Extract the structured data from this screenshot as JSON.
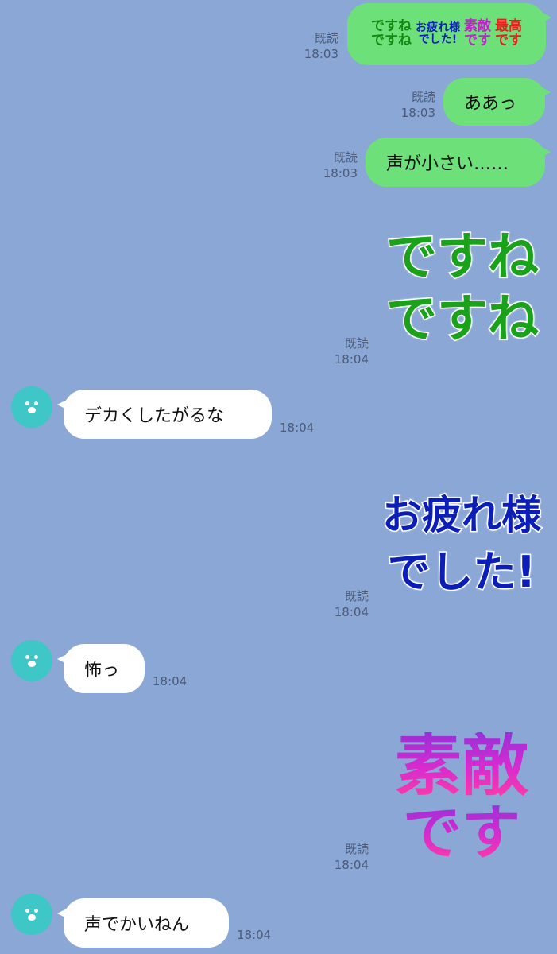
{
  "messages": [
    {
      "type": "sticker-mini",
      "read": "既読",
      "time": "18:03",
      "parts": [
        [
          "ですね",
          "ですね"
        ],
        [
          "お疲れ様",
          "でした!"
        ],
        [
          "素敵",
          "です"
        ],
        [
          "最高",
          "です"
        ]
      ]
    },
    {
      "type": "out",
      "read": "既読",
      "time": "18:03",
      "text": "ああっ"
    },
    {
      "type": "out",
      "read": "既読",
      "time": "18:03",
      "text": "声が小さい……"
    },
    {
      "type": "sticker",
      "read": "既読",
      "time": "18:04",
      "lines": [
        "ですね",
        "ですね"
      ]
    },
    {
      "type": "in",
      "time": "18:04",
      "text": "デカくしたがるな"
    },
    {
      "type": "sticker",
      "read": "既読",
      "time": "18:04",
      "lines": [
        "お疲れ様",
        "でした!"
      ]
    },
    {
      "type": "in",
      "time": "18:04",
      "text": "怖っ"
    },
    {
      "type": "sticker",
      "read": "既読",
      "time": "18:04",
      "lines": [
        "素敵",
        "です"
      ]
    },
    {
      "type": "in",
      "time": "18:04",
      "text": "声でかいねん"
    }
  ],
  "colors": {
    "background": "#8aa7d6",
    "outgoing": "#6ee07a",
    "incoming": "#ffffff",
    "avatar": "#3fc6c6"
  },
  "icons": {
    "avatar": "bear-face-icon"
  }
}
